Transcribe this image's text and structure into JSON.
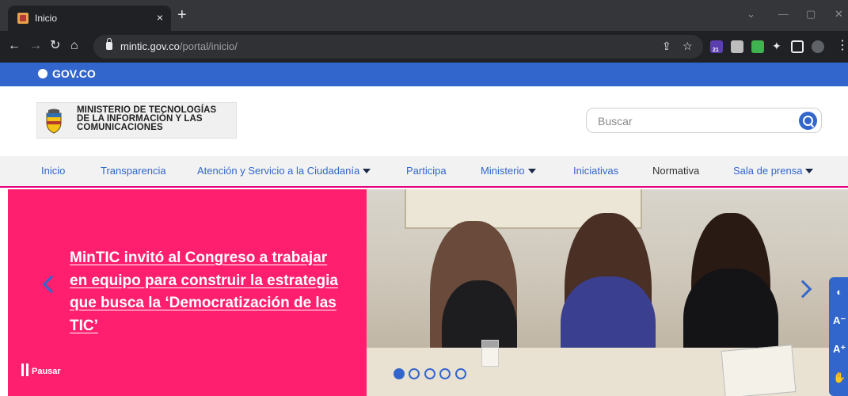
{
  "browser": {
    "tab_title": "Inicio",
    "tab_close": "×",
    "new_tab": "+",
    "url_domain": "mintic.gov.co",
    "url_path": "/portal/inicio/",
    "extension_badge": "21"
  },
  "gov_bar": {
    "logo_text": "GOV.CO"
  },
  "header": {
    "ministry_name_line1": "MINISTERIO DE TECNOLOGÍAS",
    "ministry_name_line2": "DE LA INFORMACIÓN Y LAS",
    "ministry_name_line3": "COMUNICACIONES",
    "search_placeholder": "Buscar"
  },
  "nav": {
    "items": [
      {
        "label": "Inicio"
      },
      {
        "label": "Transparencia"
      },
      {
        "label": "Atención y Servicio a la Ciudadanía"
      },
      {
        "label": "Participa"
      },
      {
        "label": "Ministerio"
      },
      {
        "label": "Iniciativas"
      },
      {
        "label": "Normativa"
      },
      {
        "label": "Sala de prensa"
      }
    ]
  },
  "hero": {
    "headline": "MinTIC invitó al Congreso a trabajar en equipo para construir la estrategia que busca la ‘Democratización de las TIC’",
    "pause_label": "Pausar",
    "slide_count": 5,
    "active_slide": 1
  },
  "colors": {
    "gov_blue": "#3366cc",
    "hero_pink": "#ff1f6e",
    "nav_accent": "#e6007e"
  }
}
